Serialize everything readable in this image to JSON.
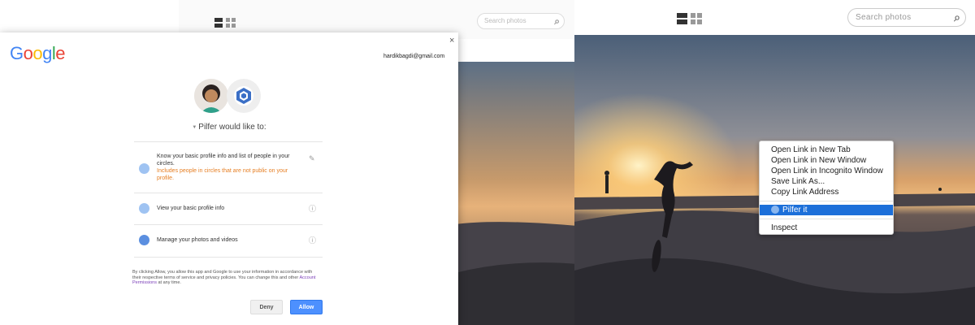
{
  "colors": {
    "google_blue": "#4285f4",
    "google_red": "#ea4335",
    "google_yellow": "#fbbc05",
    "google_green": "#34a853",
    "allow_button": "#4d90fe",
    "context_highlight": "#1c6fd9",
    "warning_text": "#e67e22"
  },
  "middle_app": {
    "search": {
      "placeholder": "Search photos"
    },
    "view_icons": [
      "list-view-icon",
      "grid-view-icon"
    ]
  },
  "right_app": {
    "search": {
      "placeholder": "Search photos"
    },
    "view_icons": [
      "list-view-icon",
      "grid-view-icon"
    ]
  },
  "context_menu": {
    "items": [
      "Open Link in New Tab",
      "Open Link in New Window",
      "Open Link in Incognito Window",
      "Save Link As...",
      "Copy Link Address"
    ],
    "highlighted": "Pilfer it",
    "last": "Inspect"
  },
  "dialog": {
    "close": "×",
    "logo": [
      "G",
      "o",
      "o",
      "g",
      "l",
      "e"
    ],
    "email": "hardikbagdi@gmail.com",
    "app_name_prefix": "Pilfer would like to:",
    "permissions": [
      {
        "icon": "person-icon",
        "text": "Know your basic profile info and list of people in your circles.",
        "subtext": "Includes people in circles that are not public on your profile.",
        "right_icon": "pencil-icon"
      },
      {
        "icon": "person-icon",
        "text": "View your basic profile info",
        "subtext": "",
        "right_icon": "info-icon"
      },
      {
        "icon": "google-plus-icon",
        "text": "Manage your photos and videos",
        "subtext": "",
        "right_icon": "info-icon"
      }
    ],
    "consent_text": "By clicking Allow, you allow this app and Google to use your information in accordance with their respective terms of service and privacy policies. You can change this and other",
    "consent_link": "Account Permissions",
    "consent_suffix": "at any time.",
    "deny_label": "Deny",
    "allow_label": "Allow"
  }
}
